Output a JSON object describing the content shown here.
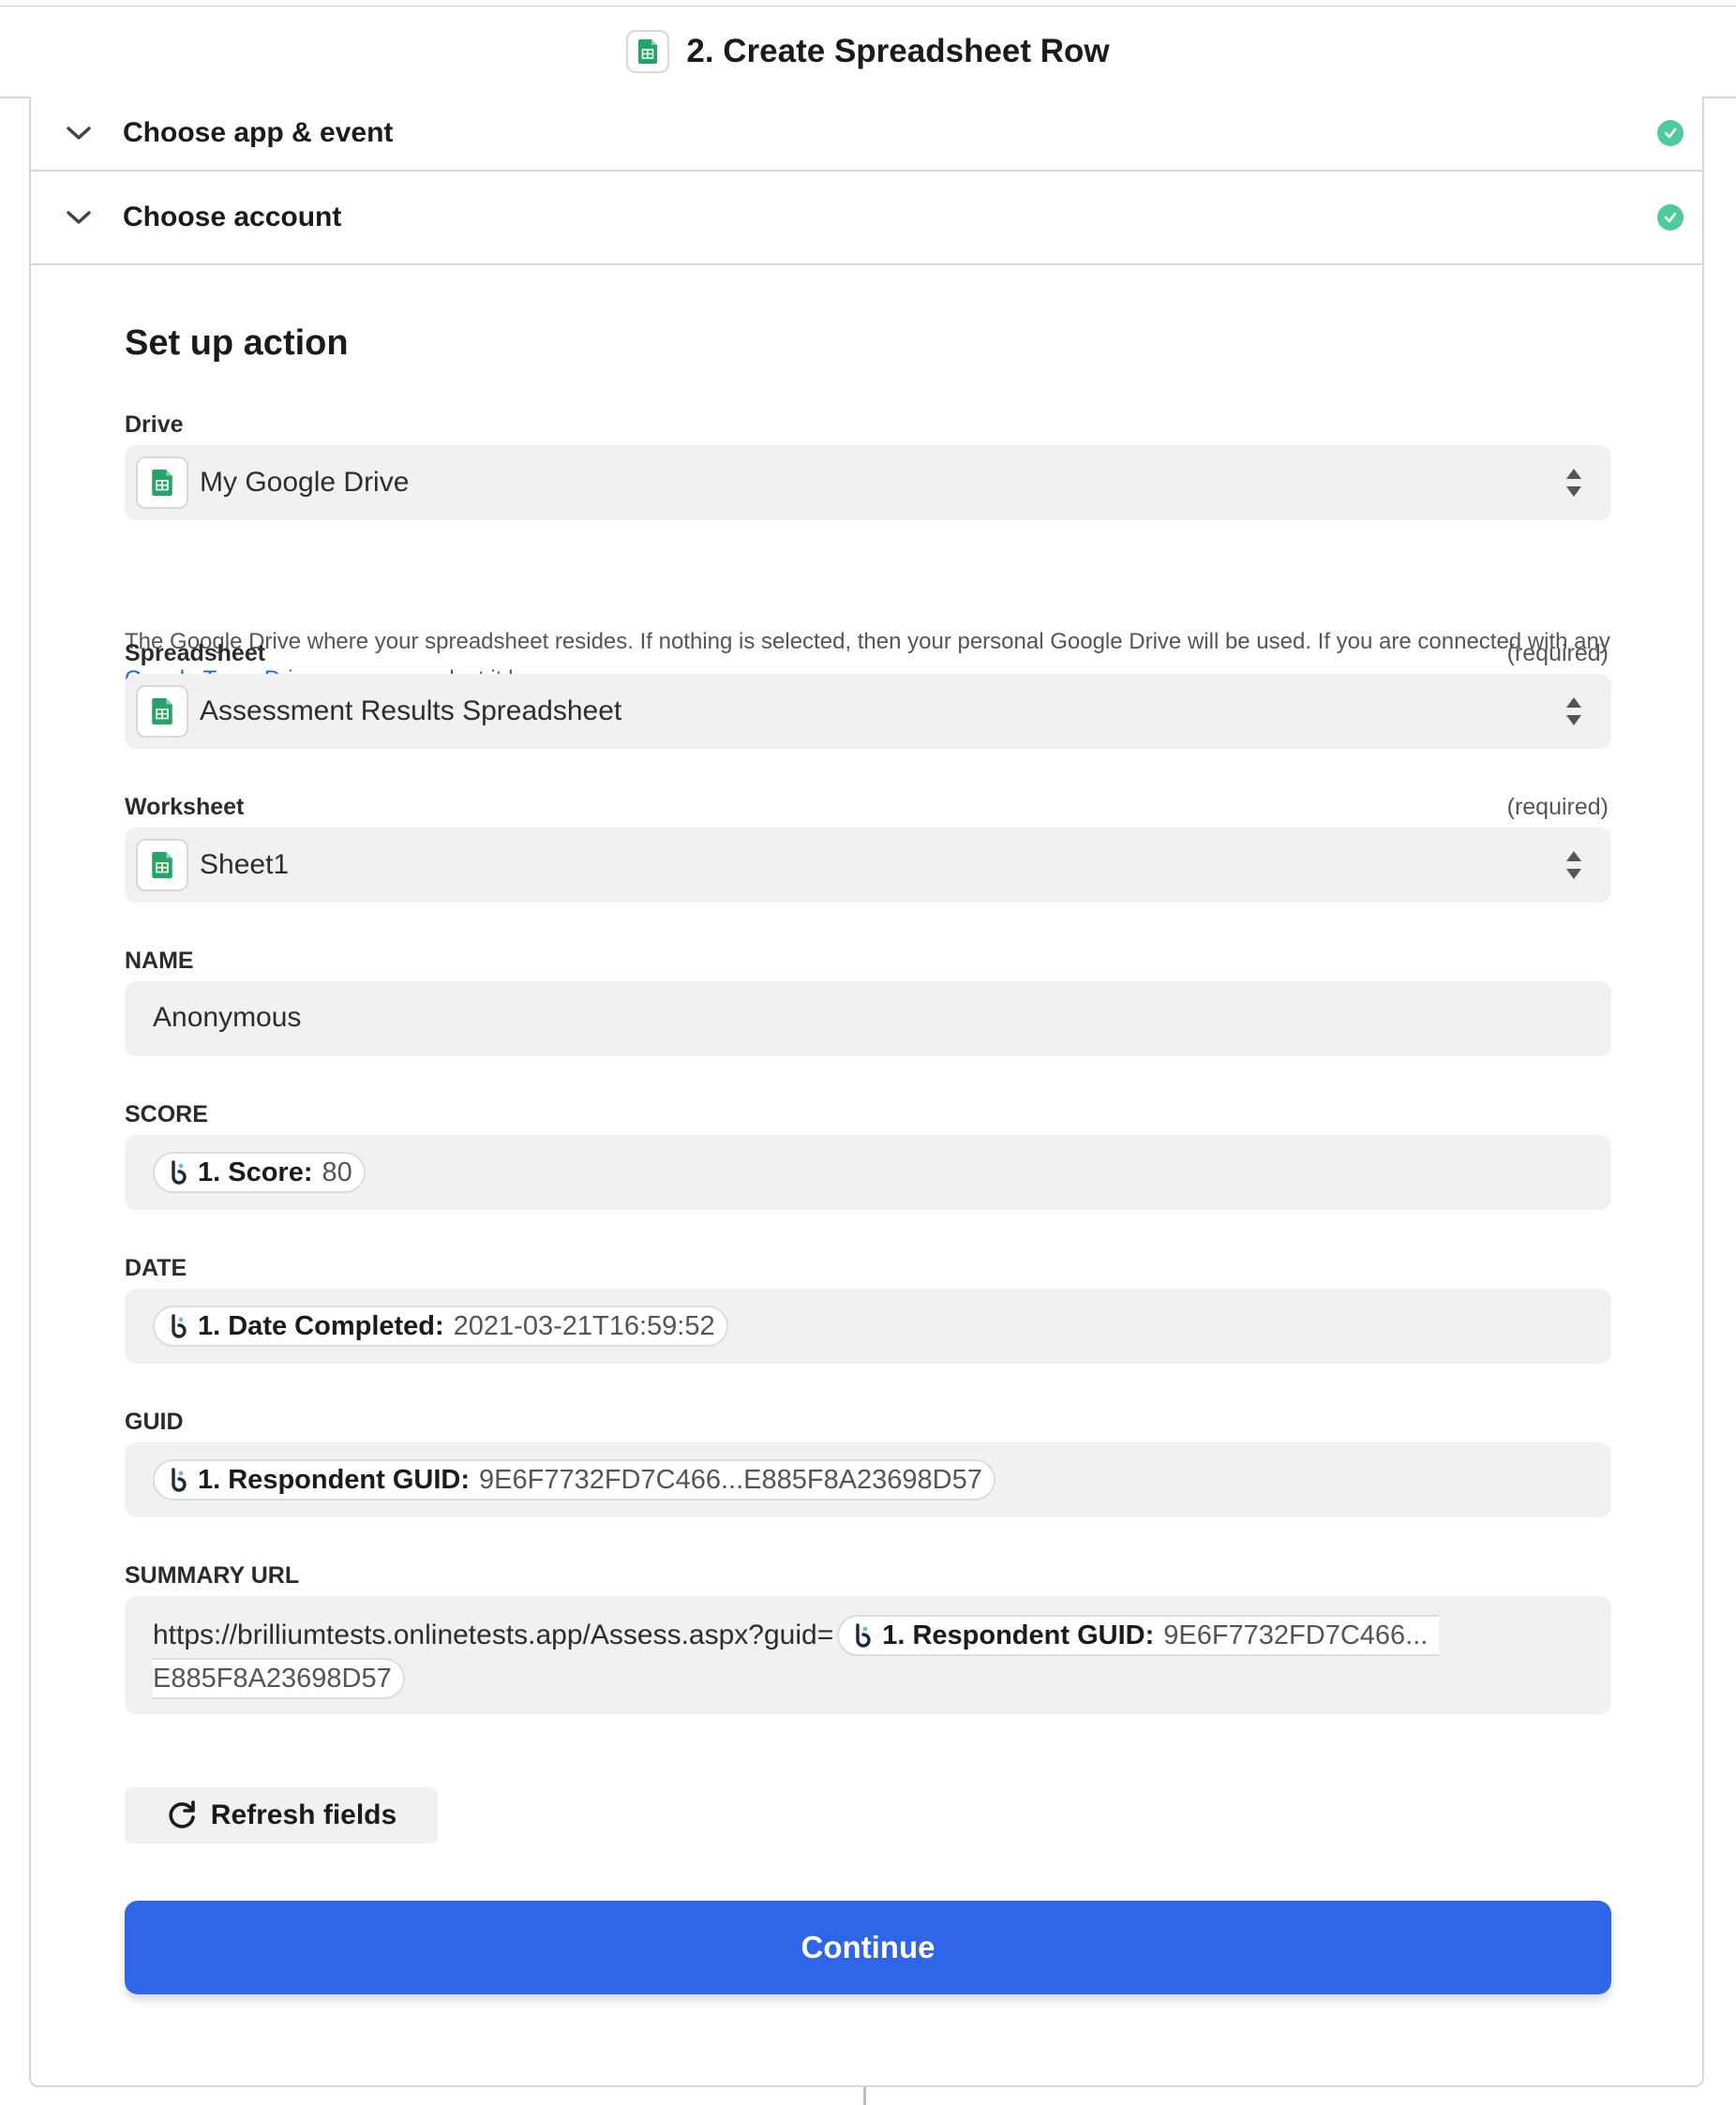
{
  "header": {
    "title": "2. Create Spreadsheet Row",
    "app_icon": "google-sheets-icon"
  },
  "accordions": [
    {
      "label": "Choose app & event",
      "status": "complete"
    },
    {
      "label": "Choose account",
      "status": "complete"
    }
  ],
  "setup": {
    "title": "Set up action",
    "drive": {
      "label": "Drive",
      "value": "My Google Drive",
      "help_before": "The Google Drive where your spreadsheet resides. If nothing is selected, then your personal Google Drive will be used. If you are connected with any ",
      "help_link": "Google Team Drives",
      "help_after": ", you can select it here."
    },
    "spreadsheet": {
      "label": "Spreadsheet",
      "required": "(required)",
      "value": "Assessment Results Spreadsheet"
    },
    "worksheet": {
      "label": "Worksheet",
      "required": "(required)",
      "value": "Sheet1"
    },
    "name": {
      "label": "NAME",
      "value": "Anonymous"
    },
    "score": {
      "label": "SCORE",
      "pill_label": "1. Score:",
      "pill_value": "80"
    },
    "date": {
      "label": "DATE",
      "pill_label": "1. Date Completed:",
      "pill_value": "2021-03-21T16:59:52"
    },
    "guid": {
      "label": "GUID",
      "pill_label": "1. Respondent GUID:",
      "pill_value": "9E6F7732FD7C466...E885F8A23698D57"
    },
    "summary_url": {
      "label": "SUMMARY URL",
      "prefix": "https://brilliumtests.onlinetests.app/Assess.aspx?guid=",
      "pill_label": "1. Respondent GUID:",
      "pill_value_line1": "9E6F7732FD7C466...",
      "pill_value_line2": "E885F8A23698D57"
    },
    "refresh_label": "Refresh fields",
    "continue_label": "Continue"
  },
  "colors": {
    "accent": "#2f66e8",
    "success": "#4ecb9a",
    "sheets_green": "#23a566",
    "link": "#1f63d8"
  }
}
